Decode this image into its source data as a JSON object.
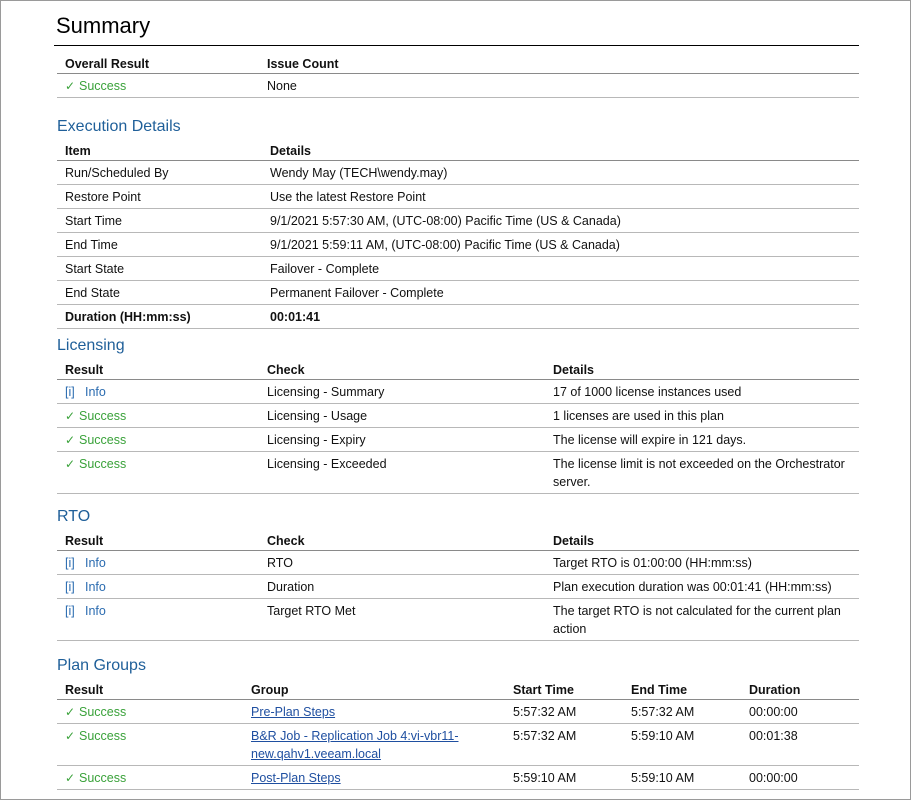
{
  "summary": {
    "title": "Summary",
    "headers": [
      "Overall Result",
      "Issue Count"
    ],
    "row": {
      "result_icon": "✓",
      "result": "Success",
      "issue_count": "None"
    }
  },
  "execution": {
    "title": "Execution Details",
    "headers": [
      "Item",
      "Details"
    ],
    "rows": [
      {
        "item": "Run/Scheduled By",
        "details": "Wendy May (TECH\\wendy.may)"
      },
      {
        "item": "Restore Point",
        "details": "Use the latest Restore Point"
      },
      {
        "item": "Start Time",
        "details": "9/1/2021 5:57:30 AM, (UTC-08:00) Pacific Time (US & Canada)"
      },
      {
        "item": "End Time",
        "details": "9/1/2021 5:59:11 AM, (UTC-08:00) Pacific Time (US & Canada)"
      },
      {
        "item": "Start State",
        "details": "Failover - Complete"
      },
      {
        "item": "End State",
        "details": "Permanent Failover - Complete"
      },
      {
        "item": "Duration (HH:mm:ss)",
        "details": "00:01:41"
      }
    ]
  },
  "licensing": {
    "title": "Licensing",
    "headers": [
      "Result",
      "Check",
      "Details"
    ],
    "rows": [
      {
        "icon": "[i]",
        "result": "Info",
        "check": "Licensing - Summary",
        "details": "17 of 1000 license instances used"
      },
      {
        "icon": "✓",
        "result": "Success",
        "check": "Licensing - Usage",
        "details": "1 licenses are used in this plan"
      },
      {
        "icon": "✓",
        "result": "Success",
        "check": "Licensing - Expiry",
        "details": "The license will expire in 121 days."
      },
      {
        "icon": "✓",
        "result": "Success",
        "check": "Licensing - Exceeded",
        "details": "The license limit is not exceeded on the Orchestrator server."
      }
    ]
  },
  "rto": {
    "title": "RTO",
    "headers": [
      "Result",
      "Check",
      "Details"
    ],
    "rows": [
      {
        "icon": "[i]",
        "result": "Info",
        "check": "RTO",
        "details": "Target RTO is 01:00:00 (HH:mm:ss)"
      },
      {
        "icon": "[i]",
        "result": "Info",
        "check": "Duration",
        "details": "Plan execution duration was 00:01:41 (HH:mm:ss)"
      },
      {
        "icon": "[i]",
        "result": "Info",
        "check": "Target RTO Met",
        "details": "The target RTO is not calculated for the current plan action"
      }
    ]
  },
  "plan_groups": {
    "title": "Plan Groups",
    "headers": [
      "Result",
      "Group",
      "Start Time",
      "End Time",
      "Duration"
    ],
    "rows": [
      {
        "icon": "✓",
        "result": "Success",
        "group": "Pre-Plan Steps",
        "start": "5:57:32 AM",
        "end": "5:57:32 AM",
        "duration": "00:00:00"
      },
      {
        "icon": "✓",
        "result": "Success",
        "group": "B&R Job - Replication Job 4:vi-vbr11-new.qahv1.veeam.local",
        "start": "5:57:32 AM",
        "end": "5:59:10 AM",
        "duration": "00:01:38"
      },
      {
        "icon": "✓",
        "result": "Success",
        "group": "Post-Plan Steps",
        "start": "5:59:10 AM",
        "end": "5:59:10 AM",
        "duration": "00:00:00"
      }
    ]
  },
  "colors": {
    "success": "#3aa23a",
    "info": "#2a6bb0",
    "section_title": "#1f5f99",
    "link": "#1f4fa0"
  }
}
